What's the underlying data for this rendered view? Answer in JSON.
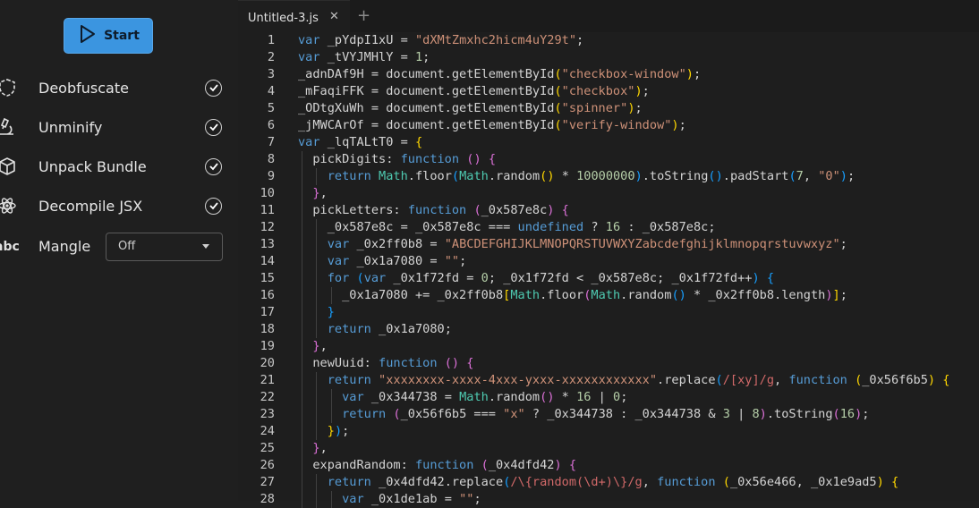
{
  "sidebar": {
    "start_label": "Start",
    "options": [
      {
        "label": "Deobfuscate",
        "icon": "shield-icon",
        "checked": true
      },
      {
        "label": "Unminify",
        "icon": "microscope-icon",
        "checked": true
      },
      {
        "label": "Unpack Bundle",
        "icon": "package-icon",
        "checked": true
      },
      {
        "label": "Decompile JSX",
        "icon": "react-icon",
        "checked": true
      }
    ],
    "mangle": {
      "label": "Mangle",
      "icon_text": "abc",
      "value": "Off"
    }
  },
  "editor": {
    "tab_title": "Untitled-3.js",
    "close_glyph": "✕",
    "new_tab_glyph": "+",
    "lines": [
      "var _pYdpI1xU = \"dXMtZmxhc2hicm4uY29t\";",
      "var _tVYJMHlY = 1;",
      "_adnDAf9H = document.getElementById(\"checkbox-window\");",
      "_mFaqiFFK = document.getElementById(\"checkbox\");",
      "_ODtgXuWh = document.getElementById(\"spinner\");",
      "_jMWCArOf = document.getElementById(\"verify-window\");",
      "var _lqTALtT0 = {",
      "  pickDigits: function () {",
      "    return Math.floor(Math.random() * 10000000).toString().padStart(7, \"0\");",
      "  },",
      "  pickLetters: function (_0x587e8c) {",
      "    _0x587e8c = _0x587e8c === undefined ? 16 : _0x587e8c;",
      "    var _0x2ff0b8 = \"ABCDEFGHIJKLMNOPQRSTUVWXYZabcdefghijklmnopqrstuvwxyz\";",
      "    var _0x1a7080 = \"\";",
      "    for (var _0x1f72fd = 0; _0x1f72fd < _0x587e8c; _0x1f72fd++) {",
      "      _0x1a7080 += _0x2ff0b8[Math.floor(Math.random() * _0x2ff0b8.length)];",
      "    }",
      "    return _0x1a7080;",
      "  },",
      "  newUuid: function () {",
      "    return \"xxxxxxxx-xxxx-4xxx-yxxx-xxxxxxxxxxxx\".replace(/[xy]/g, function (_0x56f6b5) {",
      "      var _0x344738 = Math.random() * 16 | 0;",
      "      return (_0x56f6b5 === \"x\" ? _0x344738 : _0x344738 & 3 | 8).toString(16);",
      "    });",
      "  },",
      "  expandRandom: function (_0x4dfd42) {",
      "    return _0x4dfd42.replace(/\\{random(\\d+)\\}/g, function (_0x56e466, _0x1e9ad5) {",
      "      var _0x1de1ab = \"\";"
    ]
  }
}
